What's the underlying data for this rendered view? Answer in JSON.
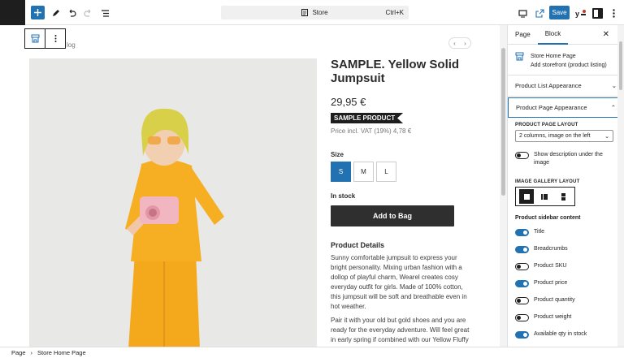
{
  "topbar": {
    "document_title": "Store",
    "shortcut": "Ctrl+K",
    "save_label": "Save"
  },
  "canvas": {
    "breadcrumb_fragment": "log",
    "product": {
      "title": "SAMPLE. Yellow Solid Jumpsuit",
      "price": "29,95 €",
      "badge": "SAMPLE PRODUCT",
      "vat": "Price incl. VAT (19%) 4,78 €",
      "size_label": "Size",
      "sizes": [
        "S",
        "M",
        "L"
      ],
      "selected_size": "S",
      "stock": "In stock",
      "add_to_bag": "Add to Bag",
      "details_heading": "Product Details",
      "description_1": "Sunny comfortable jumpsuit to express your bright personality. Mixing urban fashion with a dollop of playful charm, Wearel creates cosy everyday outfit for girls. Made of 100% cotton, this jumpsuit will be soft and breathable even in hot weather.",
      "description_2": "Pair it with your old but gold shoes and you are ready for the everyday adventure. Will feel great in early spring if combined with our Yellow Fluffy Sweater."
    }
  },
  "sidebar": {
    "tabs": [
      "Page",
      "Block"
    ],
    "active_tab": "Block",
    "block_name": "Store Home Page",
    "block_description": "Add storefront (product listing)",
    "panel_list": "Product List Appearance",
    "panel_page": "Product Page Appearance",
    "layout_label": "PRODUCT PAGE LAYOUT",
    "layout_value": "2 columns, image on the left",
    "show_description_label": "Show description under the image",
    "gallery_label": "IMAGE GALLERY LAYOUT",
    "sidebar_content_label": "Product sidebar content",
    "toggles": [
      {
        "label": "Title",
        "on": true
      },
      {
        "label": "Breadcrumbs",
        "on": true
      },
      {
        "label": "Product SKU",
        "on": false
      },
      {
        "label": "Product price",
        "on": true
      },
      {
        "label": "Product quantity",
        "on": false
      },
      {
        "label": "Product weight",
        "on": false
      },
      {
        "label": "Available qty in stock",
        "on": true
      }
    ]
  },
  "footer": {
    "crumb_1": "Page",
    "crumb_2": "Store Home Page"
  },
  "colors": {
    "accent": "#2271b1",
    "dark": "#1e1e1e",
    "product_yellow": "#f5a81c"
  }
}
